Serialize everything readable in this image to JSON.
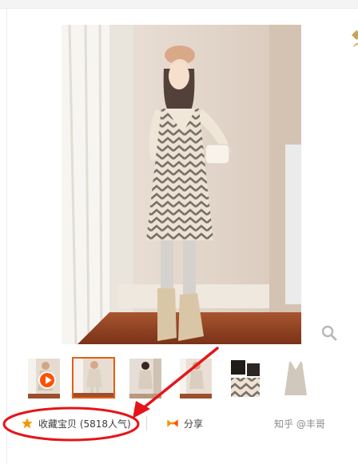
{
  "actions": {
    "favorite_label": "收藏宝贝 (5818人气)",
    "share_label": "分享"
  },
  "watermark": "知乎 @丰哥",
  "thumbnails": [
    {
      "kind": "video"
    },
    {
      "kind": "photo",
      "selected": true
    },
    {
      "kind": "photo"
    },
    {
      "kind": "photo"
    },
    {
      "kind": "detail"
    },
    {
      "kind": "flat-lay"
    }
  ],
  "colors": {
    "accent_orange": "#ff5000",
    "annotation_red": "#e5141b",
    "star_orange": "#f39800"
  },
  "icons": [
    "zoom-icon",
    "play-icon",
    "star-icon",
    "share-icon"
  ]
}
